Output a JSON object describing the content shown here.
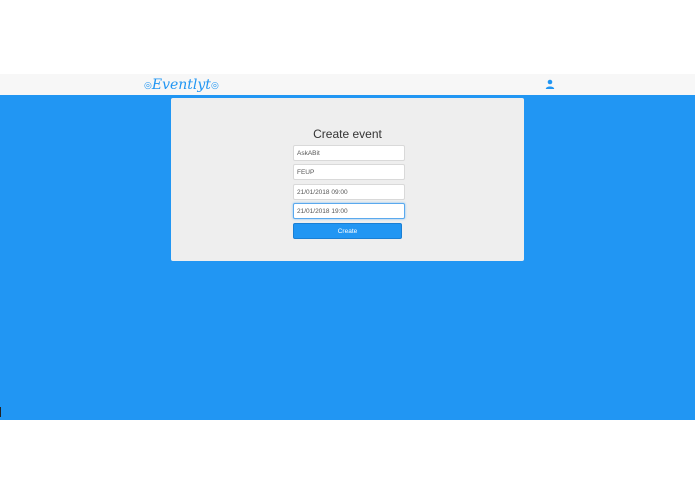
{
  "navbar": {
    "logo_text": "Eventlyt",
    "user_icon": "user-icon"
  },
  "form": {
    "title": "Create event",
    "fields": [
      {
        "name": "event-name-field",
        "value": "AskABit"
      },
      {
        "name": "event-location-field",
        "value": "FEUP"
      },
      {
        "name": "event-start-field",
        "value": "21/01/2018 09:00"
      },
      {
        "name": "event-end-field",
        "value": "21/01/2018 19:00"
      }
    ],
    "submit_label": "Create"
  },
  "colors": {
    "primary": "#2196f3",
    "card": "#eeeeee",
    "navbar": "#f7f7f7"
  }
}
